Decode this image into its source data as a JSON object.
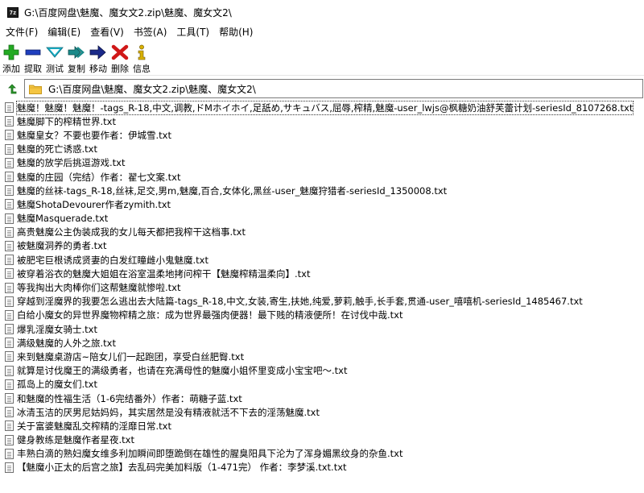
{
  "window": {
    "icon_label": "7z",
    "title": "G:\\百度网盘\\魅魔、魔女文2.zip\\魅魔、魔女文2\\"
  },
  "menu": [
    "文件(F)",
    "编辑(E)",
    "查看(V)",
    "书签(A)",
    "工具(T)",
    "帮助(H)"
  ],
  "toolbar": [
    {
      "name": "add",
      "label": "添加",
      "icon": "plus-icon",
      "color": "#22aa22"
    },
    {
      "name": "extract",
      "label": "提取",
      "icon": "minus-icon",
      "color": "#1f3fbf"
    },
    {
      "name": "test",
      "label": "测试",
      "icon": "check-icon",
      "color": "#1ab0c8"
    },
    {
      "name": "copy",
      "label": "复制",
      "icon": "double-arrow-icon",
      "color": "#1a8a8a"
    },
    {
      "name": "move",
      "label": "移动",
      "icon": "arrow-right-icon",
      "color": "#1a2a8a"
    },
    {
      "name": "delete",
      "label": "删除",
      "icon": "x-icon",
      "color": "#d01818"
    },
    {
      "name": "info",
      "label": "信息",
      "icon": "info-icon",
      "color": "#d8b000"
    }
  ],
  "address": {
    "path": "G:\\百度网盘\\魅魔、魔女文2.zip\\魅魔、魔女文2\\"
  },
  "files": [
    "魅魔！魅魔！魅魔！-tags_R-18,中文,调教,ドMホイホイ,足舐め,サキュバス,屈辱,榨精,魅魔-user_lwjs@枫糖奶油舒芙蕾计划-seriesId_8107268.txt",
    "魅魔脚下的榨精世界.txt",
    "魅魔皇女？不要也要作者：伊城雪.txt",
    "魅魔的死亡诱惑.txt",
    "魅魔的放学后挑逗游戏.txt",
    "魅魔的庄园（完结）作者：翟七文案.txt",
    "魅魔的丝袜-tags_R-18,丝袜,足交,男m,魅魔,百合,女体化,黑丝-user_魅魔狩猎者-seriesId_1350008.txt",
    "魅魔ShotaDevourer作者zymith.txt",
    "魅魔Masquerade.txt",
    "高贵魅魔公主伪装成我的女儿每天都把我榨干这档事.txt",
    "被魅魔洞养的勇者.txt",
    "被肥宅巨根诱成贤妻的白发红瞳雌小鬼魅魔.txt",
    "被穿着浴衣的魅魔大姐姐在浴室温柔地拷问榨干【魅魔榨精温柔向】.txt",
    "等我掏出大肉棒你们这帮魅魔就惨啦.txt",
    "穿越到淫魔界的我要怎么逃出去大陆篇-tags_R-18,中文,女装,寄生,扶她,纯爱,萝莉,触手,长手套,贯通-user_嘻嘻机-seriesId_1485467.txt",
    "白给小魔女的异世界魔物榨精之旅：成为世界最强肉便器！最下贱的精液便所！在讨伐中哉.txt",
    "爆乳淫魔女骑士.txt",
    "满级魅魔的人外之旅.txt",
    "来到魅魔桌游店~陪女儿们一起跑团，享受白丝肥臀.txt",
    "就算是讨伐魔王的满级勇者，也请在充满母性的魅魔小姐怀里变成小宝宝吧～.txt",
    "孤岛上的魔女们.txt",
    "和魅魔的性福生活（1-6完结番外）作者：萌糖子蓝.txt",
    "冰清玉洁的厌男尼姑妈妈，其实居然是没有精液就活不下去的淫荡魅魔.txt",
    "关于富婆魅魔乱交榨精的淫靡日常.txt",
    "健身教练是魅魔作者星夜.txt",
    "丰熟白滴的熟妇魔女维多利加瞬间即堕跪倒在雄性的腥臭阳具下沦为了浑身媚黑纹身的杂鱼.txt",
    "【魅魔小正太的后宫之旅】去乱码完美加料版（1-471完） 作者：李梦溪.txt.txt"
  ],
  "selected_index": 0
}
